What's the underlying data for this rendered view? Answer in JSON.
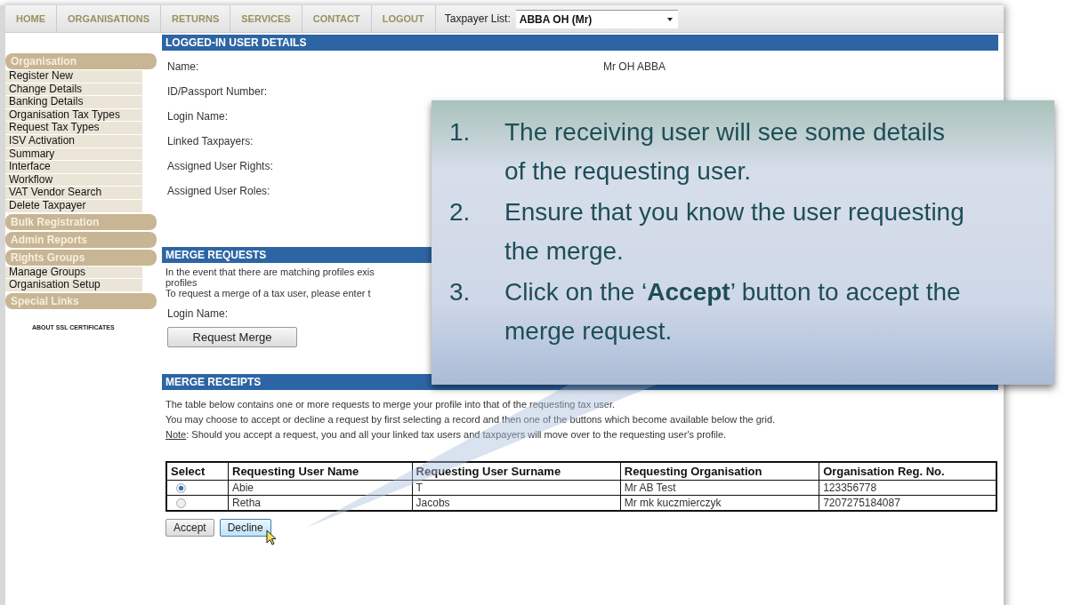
{
  "nav": {
    "items": [
      {
        "label": "HOME"
      },
      {
        "label": "ORGANISATIONS"
      },
      {
        "label": "RETURNS"
      },
      {
        "label": "SERVICES"
      },
      {
        "label": "CONTACT"
      },
      {
        "label": "LOGOUT"
      }
    ],
    "taxpayer_list": {
      "label": "Taxpayer List:",
      "value": "ABBA OH (Mr)"
    }
  },
  "sidebar": {
    "sections": [
      {
        "title": "Organisation",
        "items": [
          "Register New",
          "Change Details",
          "Banking Details",
          "Organisation Tax Types",
          "Request Tax Types",
          "ISV Activation",
          "Summary",
          "Interface",
          "Workflow",
          "VAT Vendor Search",
          "Delete Taxpayer"
        ]
      },
      {
        "title": "Bulk Registration"
      },
      {
        "title": "Admin Reports"
      },
      {
        "title": "Rights Groups",
        "items": [
          "Manage Groups",
          "Organisation Setup"
        ]
      },
      {
        "title": "Special Links"
      }
    ],
    "link": "ABOUT SSL CERTIFICATES"
  },
  "user_details": {
    "title": "LOGGED-IN USER DETAILS",
    "fields": [
      {
        "label": "Name:",
        "value": "Mr OH ABBA"
      },
      {
        "label": "ID/Passport Number:"
      },
      {
        "label": "Login Name:"
      },
      {
        "label": "Linked Taxpayers:"
      },
      {
        "label": "Assigned User Rights:"
      },
      {
        "label": "Assigned User Roles:"
      }
    ]
  },
  "merge_requests": {
    "title": "MERGE REQUESTS",
    "text_lines": [
      "In the event that there are matching profiles exis",
      "profiles",
      "To request a merge of a tax user, please enter t"
    ],
    "login_label": "Login Name:",
    "button": "Request Merge"
  },
  "merge_receipts": {
    "title": "MERGE RECEIPTS",
    "lines": [
      "The table below contains one or more requests to merge your profile into that of the requesting tax user.",
      "You may choose to accept or decline a request by first selecting a record and then one of the buttons which become available below the grid."
    ],
    "note_label": "Note",
    "note_text": ": Should you accept a request, you and all your linked tax users and taxpayers will move over to the requesting user's profile.",
    "table": {
      "select_column": "Select",
      "columns": [
        "Requesting User Name",
        "Requesting User Surname",
        "Requesting Organisation",
        "Organisation Reg. No."
      ],
      "rows": [
        {
          "selected": true,
          "cells": [
            "Abie",
            "T",
            "Mr AB Test",
            "123356778"
          ]
        },
        {
          "selected": false,
          "cells": [
            "Retha",
            "Jacobs",
            "Mr mk kuczmierczyk",
            "7207275184087"
          ]
        }
      ]
    },
    "buttons": [
      {
        "label": "Accept",
        "hovered": false
      },
      {
        "label": "Decline",
        "hovered": true
      }
    ]
  },
  "callout": {
    "steps": [
      {
        "number": "1.",
        "text": "The receiving user will see some details of the requesting user."
      },
      {
        "number": "2.",
        "text": "Ensure that you know the user requesting the merge."
      },
      {
        "number": "3.",
        "text": "Click on the ‘**Accept**’ button to accept the merge request."
      }
    ]
  }
}
